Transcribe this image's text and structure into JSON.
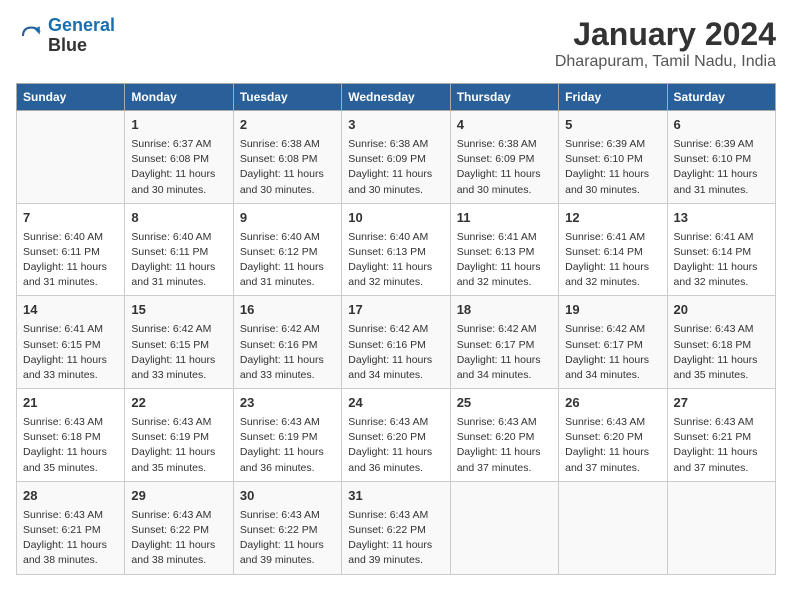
{
  "logo": {
    "line1": "General",
    "line2": "Blue"
  },
  "title": "January 2024",
  "subtitle": "Dharapuram, Tamil Nadu, India",
  "days_of_week": [
    "Sunday",
    "Monday",
    "Tuesday",
    "Wednesday",
    "Thursday",
    "Friday",
    "Saturday"
  ],
  "weeks": [
    [
      {
        "day": "",
        "content": ""
      },
      {
        "day": "1",
        "content": "Sunrise: 6:37 AM\nSunset: 6:08 PM\nDaylight: 11 hours\nand 30 minutes."
      },
      {
        "day": "2",
        "content": "Sunrise: 6:38 AM\nSunset: 6:08 PM\nDaylight: 11 hours\nand 30 minutes."
      },
      {
        "day": "3",
        "content": "Sunrise: 6:38 AM\nSunset: 6:09 PM\nDaylight: 11 hours\nand 30 minutes."
      },
      {
        "day": "4",
        "content": "Sunrise: 6:38 AM\nSunset: 6:09 PM\nDaylight: 11 hours\nand 30 minutes."
      },
      {
        "day": "5",
        "content": "Sunrise: 6:39 AM\nSunset: 6:10 PM\nDaylight: 11 hours\nand 30 minutes."
      },
      {
        "day": "6",
        "content": "Sunrise: 6:39 AM\nSunset: 6:10 PM\nDaylight: 11 hours\nand 31 minutes."
      }
    ],
    [
      {
        "day": "7",
        "content": "Sunrise: 6:40 AM\nSunset: 6:11 PM\nDaylight: 11 hours\nand 31 minutes."
      },
      {
        "day": "8",
        "content": "Sunrise: 6:40 AM\nSunset: 6:11 PM\nDaylight: 11 hours\nand 31 minutes."
      },
      {
        "day": "9",
        "content": "Sunrise: 6:40 AM\nSunset: 6:12 PM\nDaylight: 11 hours\nand 31 minutes."
      },
      {
        "day": "10",
        "content": "Sunrise: 6:40 AM\nSunset: 6:13 PM\nDaylight: 11 hours\nand 32 minutes."
      },
      {
        "day": "11",
        "content": "Sunrise: 6:41 AM\nSunset: 6:13 PM\nDaylight: 11 hours\nand 32 minutes."
      },
      {
        "day": "12",
        "content": "Sunrise: 6:41 AM\nSunset: 6:14 PM\nDaylight: 11 hours\nand 32 minutes."
      },
      {
        "day": "13",
        "content": "Sunrise: 6:41 AM\nSunset: 6:14 PM\nDaylight: 11 hours\nand 32 minutes."
      }
    ],
    [
      {
        "day": "14",
        "content": "Sunrise: 6:41 AM\nSunset: 6:15 PM\nDaylight: 11 hours\nand 33 minutes."
      },
      {
        "day": "15",
        "content": "Sunrise: 6:42 AM\nSunset: 6:15 PM\nDaylight: 11 hours\nand 33 minutes."
      },
      {
        "day": "16",
        "content": "Sunrise: 6:42 AM\nSunset: 6:16 PM\nDaylight: 11 hours\nand 33 minutes."
      },
      {
        "day": "17",
        "content": "Sunrise: 6:42 AM\nSunset: 6:16 PM\nDaylight: 11 hours\nand 34 minutes."
      },
      {
        "day": "18",
        "content": "Sunrise: 6:42 AM\nSunset: 6:17 PM\nDaylight: 11 hours\nand 34 minutes."
      },
      {
        "day": "19",
        "content": "Sunrise: 6:42 AM\nSunset: 6:17 PM\nDaylight: 11 hours\nand 34 minutes."
      },
      {
        "day": "20",
        "content": "Sunrise: 6:43 AM\nSunset: 6:18 PM\nDaylight: 11 hours\nand 35 minutes."
      }
    ],
    [
      {
        "day": "21",
        "content": "Sunrise: 6:43 AM\nSunset: 6:18 PM\nDaylight: 11 hours\nand 35 minutes."
      },
      {
        "day": "22",
        "content": "Sunrise: 6:43 AM\nSunset: 6:19 PM\nDaylight: 11 hours\nand 35 minutes."
      },
      {
        "day": "23",
        "content": "Sunrise: 6:43 AM\nSunset: 6:19 PM\nDaylight: 11 hours\nand 36 minutes."
      },
      {
        "day": "24",
        "content": "Sunrise: 6:43 AM\nSunset: 6:20 PM\nDaylight: 11 hours\nand 36 minutes."
      },
      {
        "day": "25",
        "content": "Sunrise: 6:43 AM\nSunset: 6:20 PM\nDaylight: 11 hours\nand 37 minutes."
      },
      {
        "day": "26",
        "content": "Sunrise: 6:43 AM\nSunset: 6:20 PM\nDaylight: 11 hours\nand 37 minutes."
      },
      {
        "day": "27",
        "content": "Sunrise: 6:43 AM\nSunset: 6:21 PM\nDaylight: 11 hours\nand 37 minutes."
      }
    ],
    [
      {
        "day": "28",
        "content": "Sunrise: 6:43 AM\nSunset: 6:21 PM\nDaylight: 11 hours\nand 38 minutes."
      },
      {
        "day": "29",
        "content": "Sunrise: 6:43 AM\nSunset: 6:22 PM\nDaylight: 11 hours\nand 38 minutes."
      },
      {
        "day": "30",
        "content": "Sunrise: 6:43 AM\nSunset: 6:22 PM\nDaylight: 11 hours\nand 39 minutes."
      },
      {
        "day": "31",
        "content": "Sunrise: 6:43 AM\nSunset: 6:22 PM\nDaylight: 11 hours\nand 39 minutes."
      },
      {
        "day": "",
        "content": ""
      },
      {
        "day": "",
        "content": ""
      },
      {
        "day": "",
        "content": ""
      }
    ]
  ]
}
